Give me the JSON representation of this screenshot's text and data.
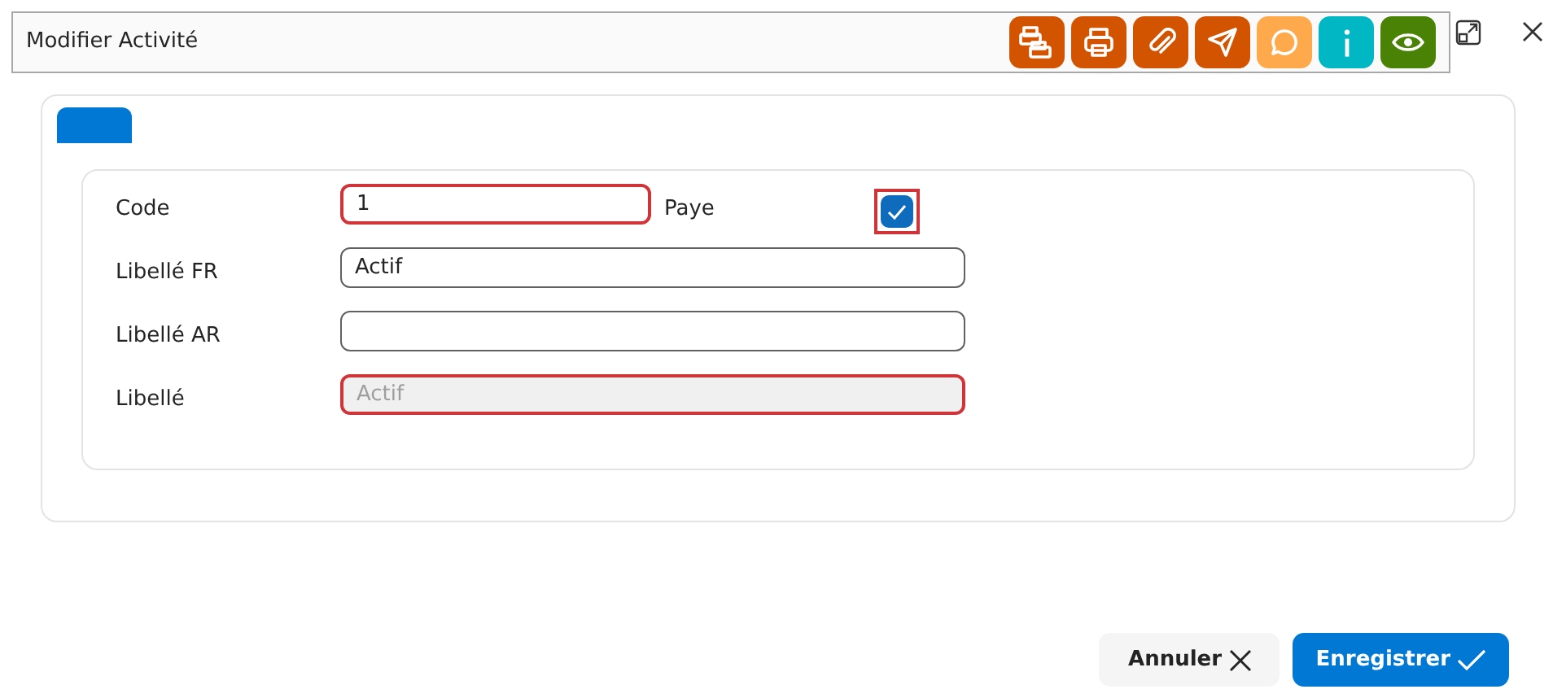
{
  "window": {
    "title": "Modifier Activité"
  },
  "toolbar": [
    {
      "kind": "printers",
      "color": "#d35400"
    },
    {
      "kind": "print",
      "color": "#d35400"
    },
    {
      "kind": "attach",
      "color": "#d35400"
    },
    {
      "kind": "send",
      "color": "#d35400"
    },
    {
      "kind": "comment",
      "color": "#ffa94d"
    },
    {
      "kind": "info",
      "color": "#00b7c3"
    },
    {
      "kind": "view",
      "color": "#498205"
    }
  ],
  "tabs": [
    {
      "selected": true
    }
  ],
  "fields": [
    {
      "label": "Code",
      "value": "1",
      "kind": "input",
      "invalid": true
    },
    {
      "label": "Libellé FR",
      "value": "Actif",
      "kind": "input",
      "invalid": false
    },
    {
      "label": "Libellé AR",
      "kind": "input",
      "invalid": false
    },
    {
      "label": "Libellé",
      "value": "Actif",
      "kind": "disabled",
      "invalid": true
    }
  ],
  "checkbox": {
    "label": "Paye",
    "checked": true,
    "invalid": true
  },
  "buttons": [
    {
      "label": "Annuler",
      "kind": "cancel"
    },
    {
      "label": "Enregistrer",
      "kind": "save"
    }
  ]
}
